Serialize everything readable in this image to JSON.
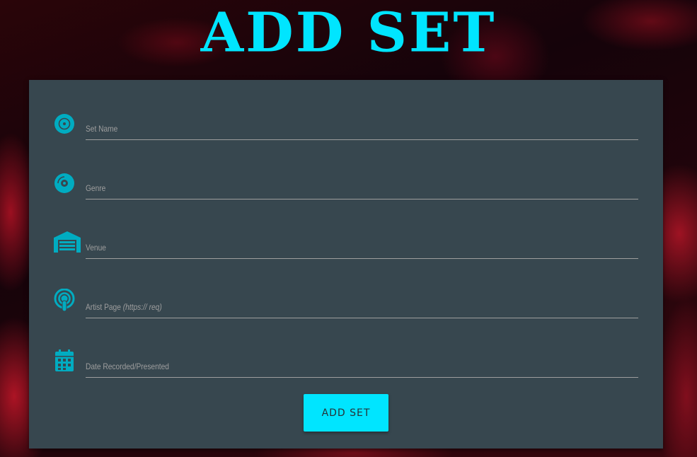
{
  "title": "ADD SET",
  "accent_color": "#00e5ff",
  "card_color": "#37474f",
  "form": {
    "fields": [
      {
        "name": "set-name",
        "icon": "disc-icon",
        "label": "Set Name",
        "value": ""
      },
      {
        "name": "genre",
        "icon": "album-icon",
        "label": "Genre",
        "value": ""
      },
      {
        "name": "venue",
        "icon": "warehouse-icon",
        "label": "Venue",
        "value": ""
      },
      {
        "name": "artist-page",
        "icon": "podcast-icon",
        "label": "Artist Page",
        "hint": "(https:// req)",
        "value": ""
      },
      {
        "name": "date",
        "icon": "calendar-icon",
        "label": "Date Recorded/Presented",
        "value": ""
      }
    ],
    "submit_label": "ADD SET"
  }
}
